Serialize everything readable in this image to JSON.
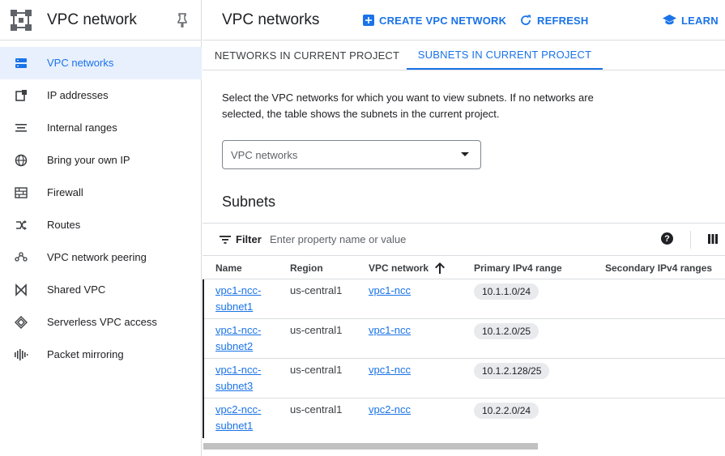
{
  "sidebar": {
    "title": "VPC network",
    "items": [
      {
        "label": "VPC networks",
        "icon": "vpc-networks-icon",
        "active": true
      },
      {
        "label": "IP addresses",
        "icon": "ip-addresses-icon"
      },
      {
        "label": "Internal ranges",
        "icon": "internal-ranges-icon"
      },
      {
        "label": "Bring your own IP",
        "icon": "globe-icon"
      },
      {
        "label": "Firewall",
        "icon": "firewall-icon"
      },
      {
        "label": "Routes",
        "icon": "routes-icon"
      },
      {
        "label": "VPC network peering",
        "icon": "peering-icon"
      },
      {
        "label": "Shared VPC",
        "icon": "shared-vpc-icon"
      },
      {
        "label": "Serverless VPC access",
        "icon": "serverless-icon"
      },
      {
        "label": "Packet mirroring",
        "icon": "packet-mirroring-icon"
      }
    ]
  },
  "header": {
    "title": "VPC networks",
    "create_label": "CREATE VPC NETWORK",
    "refresh_label": "REFRESH",
    "learn_label": "LEARN"
  },
  "tabs": [
    {
      "label": "NETWORKS IN CURRENT PROJECT",
      "active": false
    },
    {
      "label": "SUBNETS IN CURRENT PROJECT",
      "active": true
    }
  ],
  "description": "Select the VPC networks for which you want to view subnets. If no networks are selected, the table shows the subnets in the current project.",
  "network_select": {
    "placeholder": "VPC networks"
  },
  "subnets": {
    "title": "Subnets",
    "filter_label": "Filter",
    "filter_placeholder": "Enter property name or value",
    "help_label": "?",
    "columns": [
      "Name",
      "Region",
      "VPC network",
      "Primary IPv4 range",
      "Secondary IPv4 ranges"
    ],
    "sort_column": "VPC network",
    "sort_direction": "ascending",
    "rows": [
      {
        "name_line1": "vpc1-ncc-",
        "name_line2": "subnet1",
        "region": "us-central1",
        "network": "vpc1-ncc",
        "primary": "10.1.1.0/24",
        "secondary": ""
      },
      {
        "name_line1": "vpc1-ncc-",
        "name_line2": "subnet2",
        "region": "us-central1",
        "network": "vpc1-ncc",
        "primary": "10.1.2.0/25",
        "secondary": ""
      },
      {
        "name_line1": "vpc1-ncc-",
        "name_line2": "subnet3",
        "region": "us-central1",
        "network": "vpc1-ncc",
        "primary": "10.1.2.128/25",
        "secondary": ""
      },
      {
        "name_line1": "vpc2-ncc-",
        "name_line2": "subnet1",
        "region": "us-central1",
        "network": "vpc2-ncc",
        "primary": "10.2.2.0/24",
        "secondary": ""
      }
    ]
  },
  "colors": {
    "accent": "#1a73e8",
    "active_bg": "#e8f0fe",
    "chip_bg": "#e8eaed",
    "border": "#dadce0"
  }
}
